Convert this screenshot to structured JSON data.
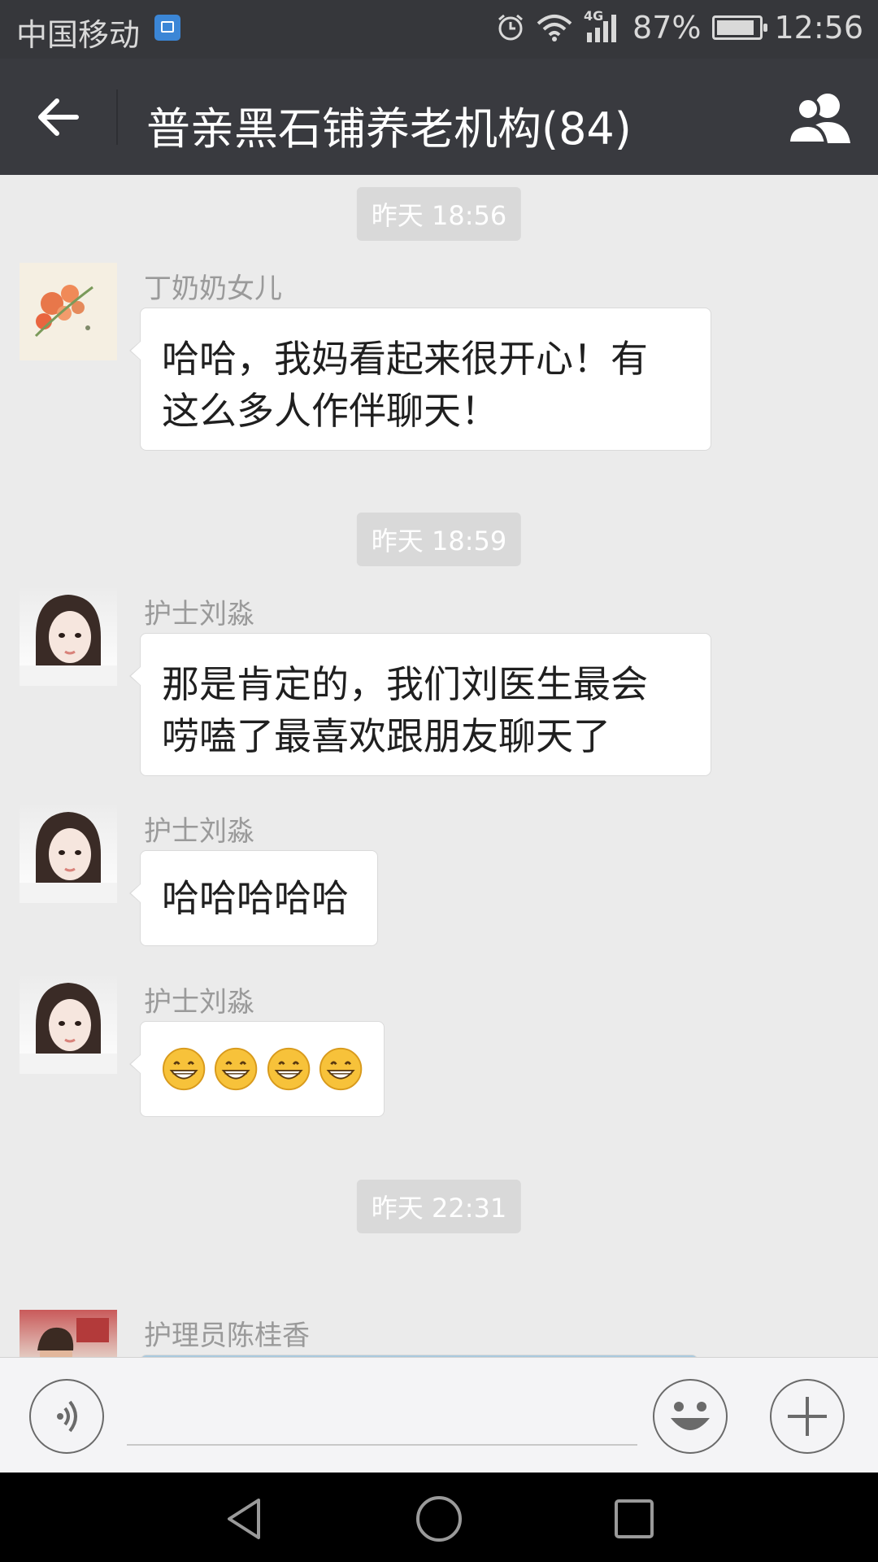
{
  "status_bar": {
    "carrier": "中国移动",
    "network": "4G",
    "battery": "87%",
    "time": "12:56"
  },
  "title_bar": {
    "title": "普亲黑石铺养老机构(84)"
  },
  "messages": [
    {
      "type": "timestamp",
      "text": "昨天 18:56"
    },
    {
      "type": "message",
      "sender": "丁奶奶女儿",
      "lines": [
        "哈哈，我妈看起来很开心！有",
        "这么多人作伴聊天！"
      ]
    },
    {
      "type": "timestamp",
      "text": "昨天 18:59"
    },
    {
      "type": "message",
      "sender": "护士刘淼",
      "lines": [
        "那是肯定的，我们刘医生最会",
        "唠嗑了最喜欢跟朋友聊天了"
      ]
    },
    {
      "type": "message",
      "sender": "护士刘淼",
      "lines": [
        "哈哈哈哈哈"
      ]
    },
    {
      "type": "message",
      "sender": "护士刘淼",
      "emoji": [
        "grinning-face",
        "grinning-face",
        "grinning-face",
        "grinning-face"
      ]
    },
    {
      "type": "timestamp",
      "text": "昨天 22:31"
    },
    {
      "type": "message",
      "sender": "护理员陈桂香",
      "image": true
    }
  ],
  "input_bar": {
    "placeholder": ""
  },
  "colors": {
    "title_bar": "#393a3f",
    "status_bar": "#36373b",
    "chat_bg": "#ebebeb",
    "bubble": "#ffffff"
  }
}
